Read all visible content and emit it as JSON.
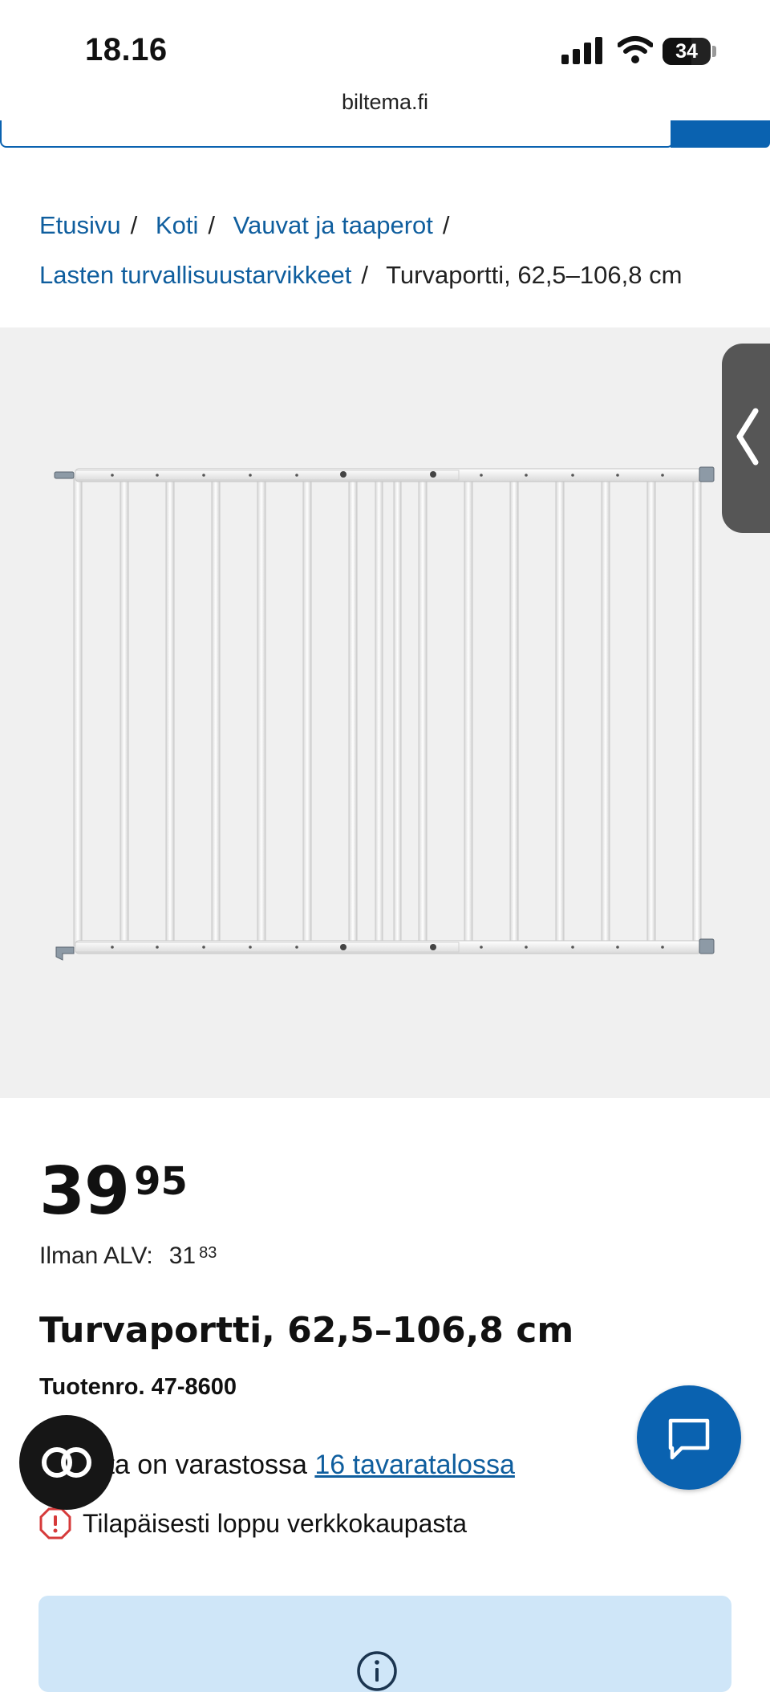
{
  "status_bar": {
    "time": "18.16",
    "battery": "34"
  },
  "browser": {
    "url": "biltema.fi"
  },
  "breadcrumb": {
    "items": [
      "Etusivu",
      "Koti",
      "Vauvat ja taaperot",
      "Lasten turvallisuustarvikkeet"
    ],
    "separator": "/",
    "current": "Turvaportti, 62,5–106,8 cm"
  },
  "product": {
    "price_main": "39",
    "price_decimals": "95",
    "vat_label": "Ilman ALV:",
    "vat_main": "31",
    "vat_decimals": "83",
    "title": "Turvaportti, 62,5–106,8 cm",
    "sku": "Tuotenro. 47-8600",
    "stock_text": "tta on varastossa",
    "stock_link": "16 tavaratalossa",
    "notice": "Tilapäisesti loppu verkkokaupasta"
  },
  "icons": {
    "gallery_toggle": "chevron-left-icon",
    "chat": "chat-bubble-icon",
    "reader": "reader-mode-icon",
    "notice": "alert-octagon-icon",
    "info": "info-icon"
  },
  "colors": {
    "brand_blue": "#0a62b0",
    "link_blue": "#0f5e9e",
    "info_bg": "#cfe6f8",
    "alert_red": "#d63a3a"
  }
}
